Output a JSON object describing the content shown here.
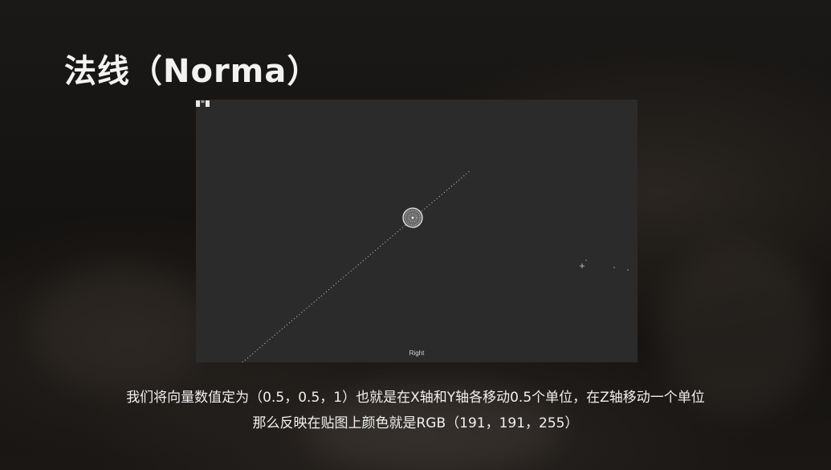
{
  "slide": {
    "title": "法线（Norma）",
    "caption_line1": "我们将向量数值定为（0.5，0.5，1）也就是在X轴和Y轴各移动0.5个单位，在Z轴移动一个单位",
    "caption_line2": "那么反映在贴图上颜色就是RGB（191，191，255）"
  },
  "viewport": {
    "view_label": "Right",
    "background_color": "#2b2b2b",
    "sphere_icon": "dotted-sphere-icon",
    "gizmo_icon": "view-cube-icon"
  }
}
